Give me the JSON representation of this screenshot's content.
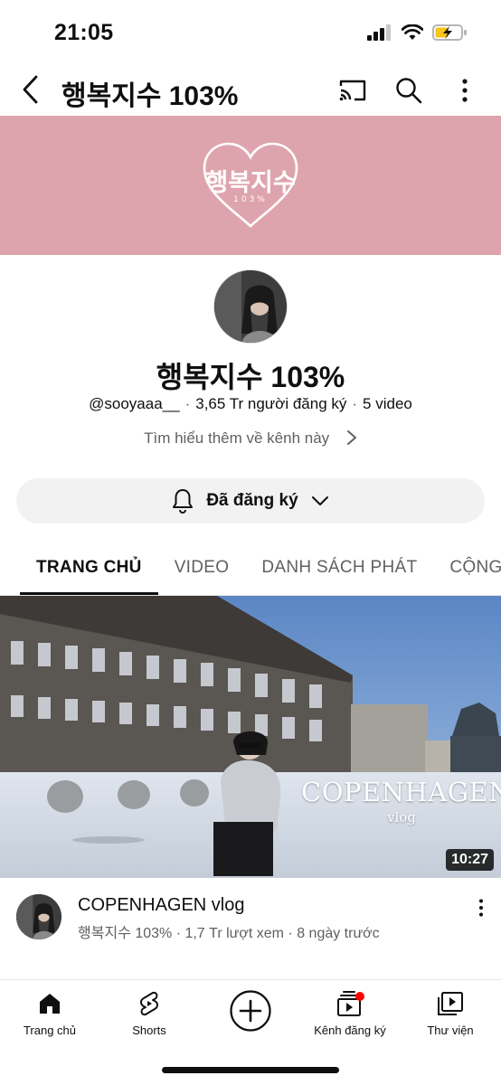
{
  "status": {
    "time": "21:05"
  },
  "header": {
    "title": "행복지수 103%"
  },
  "banner": {
    "logo_text": "행복지수",
    "logo_sub": "103%"
  },
  "channel": {
    "name": "행복지수 103%",
    "handle": "@sooyaaa__",
    "subscribers": "3,65 Tr người đăng ký",
    "video_count": "5 video",
    "about_link": "Tìm hiểu thêm về kênh này",
    "subscribe_label": "Đã đăng ký"
  },
  "tabs": [
    "TRANG CHỦ",
    "VIDEO",
    "DANH SÁCH PHÁT",
    "CỘNG ĐỒNG"
  ],
  "featured_video": {
    "thumb_title": "COPENHAGEN",
    "thumb_sub": "vlog",
    "duration": "10:27",
    "title": "COPENHAGEN vlog",
    "meta": "행복지수 103% · 1,7 Tr lượt xem · 8 ngày trước"
  },
  "bottom_nav": [
    {
      "label": "Trang chủ",
      "icon": "home-icon"
    },
    {
      "label": "Shorts",
      "icon": "shorts-icon"
    },
    {
      "label": "",
      "icon": "create-icon"
    },
    {
      "label": "Kênh đăng ký",
      "icon": "subscriptions-icon"
    },
    {
      "label": "Thư viện",
      "icon": "library-icon"
    }
  ],
  "colors": {
    "banner": "#dea4ad",
    "notification_dot": "#ff0000",
    "battery": "#f5c518"
  }
}
